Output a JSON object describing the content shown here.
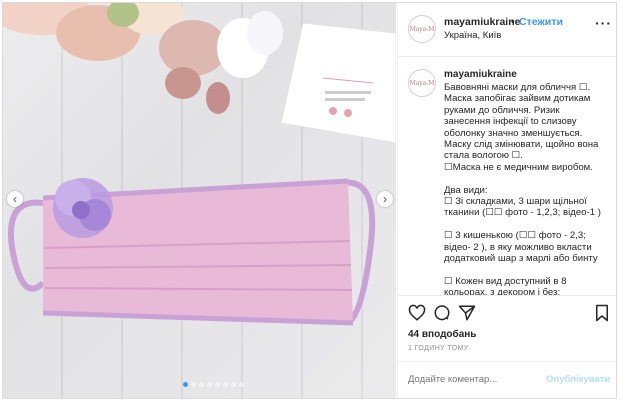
{
  "post": {
    "username": "mayamiukraine",
    "follow_separator": "•",
    "follow_label": "Стежити",
    "location": "Україна, Київ",
    "more_label": "···",
    "avatar_text": "Maya-M"
  },
  "caption": {
    "username": "mayamiukraine",
    "lines": [
      "Бавовняні маски для обличчя ☐.",
      "Маска запобігає зайвим дотикам",
      "руками до обличчя. Ризик",
      "занесення інфекції to слизову",
      "оболонку значно зменшується.",
      "Маску слід змінювати, щойно вона",
      "стала вологою ☐.",
      "☐Маска не є медичним виробом.",
      "",
      "Два види:",
      "☐ Зі складками, 3 шари щільної",
      "тканини (☐☐ фото - 1,2,3; відео-1 )",
      "",
      "☐ 3 кишенькою (☐☐ фото - 2,3;",
      "відео- 2 ), в яку можливо вкласти",
      "додатковий шар з марлі або бинту",
      "",
      "☐ Кожен вид доступний в 8",
      "кольорах, з декором і без;"
    ]
  },
  "actions": {
    "like_icon": "heart-icon",
    "comment_icon": "comment-icon",
    "share_icon": "share-icon",
    "save_icon": "bookmark-icon"
  },
  "stats": {
    "likes": "44 вподобань",
    "time": "1 ГОДИНУ ТОМУ"
  },
  "comment": {
    "placeholder": "Додайте коментар...",
    "publish_label": "Опублікувати"
  },
  "card": {
    "brand": "Maya-M"
  },
  "carousel": {
    "left_arrow": "‹",
    "right_arrow": "›",
    "total_slides": 8,
    "active_slide": 1
  },
  "colors": {
    "accent": "#3897f0",
    "publish_disabled": "#b2dffc",
    "mask": "#e9b9d8",
    "straps": "#c9a1d6",
    "flower": "#b99be0"
  }
}
